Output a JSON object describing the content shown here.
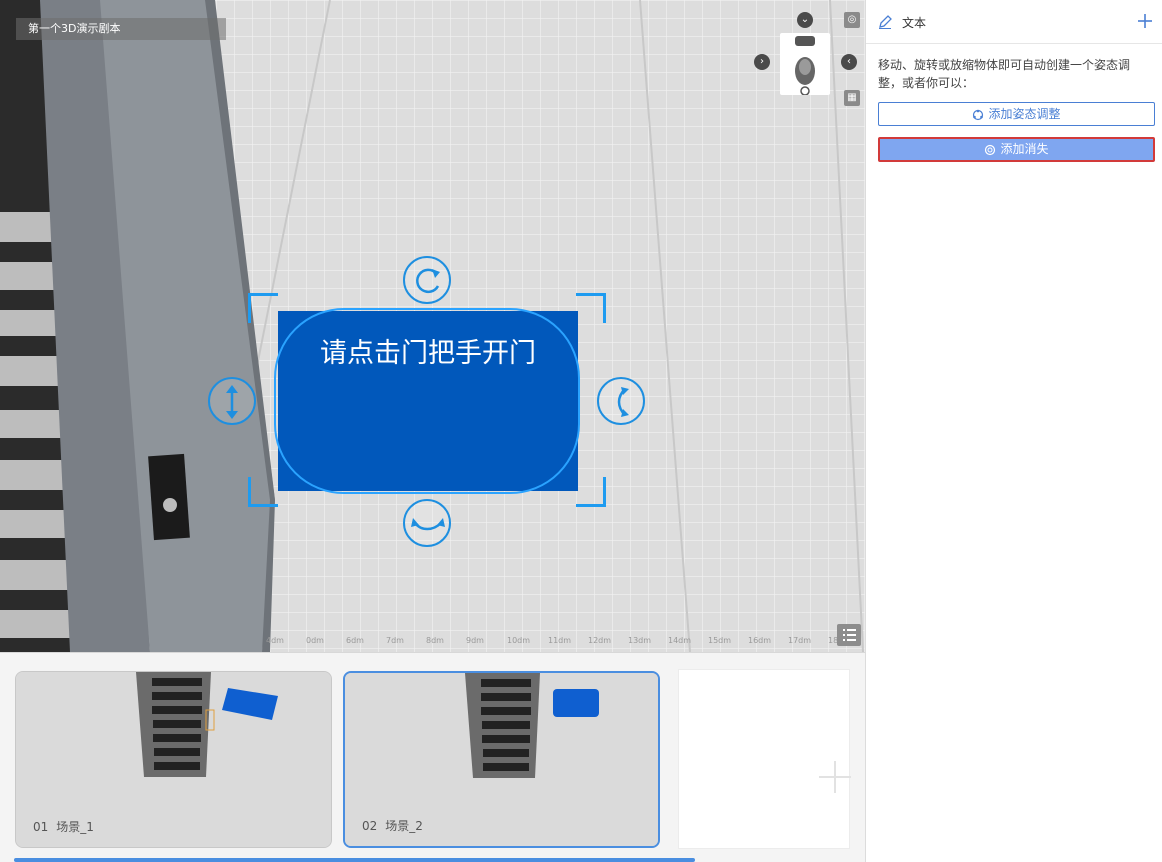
{
  "viewport": {
    "scene_title": "第一个3D演示剧本",
    "text_card": {
      "label": "请点击门把手开门"
    },
    "ruler_ticks": [
      "4dm",
      "0dm",
      "6dm",
      "7dm",
      "8dm",
      "9dm",
      "10dm",
      "11dm",
      "12dm",
      "13dm",
      "14dm",
      "15dm",
      "16dm",
      "17dm",
      "18dm"
    ]
  },
  "timeline": {
    "scenes": [
      {
        "index": "01",
        "name": "场景_1",
        "active": false
      },
      {
        "index": "02",
        "name": "场景_2",
        "active": true
      }
    ]
  },
  "panel": {
    "title": "文本",
    "hint": "移动、旋转或放缩物体即可自动创建一个姿态调整，或者你可以：",
    "add_pose_label": "添加姿态调整",
    "add_vanish_label": "添加消失"
  },
  "colors": {
    "accent": "#4a8ee0",
    "card_blue": "#0158bb",
    "gizmo_blue": "#1e9bf0",
    "highlight_red": "#d23a3a"
  }
}
